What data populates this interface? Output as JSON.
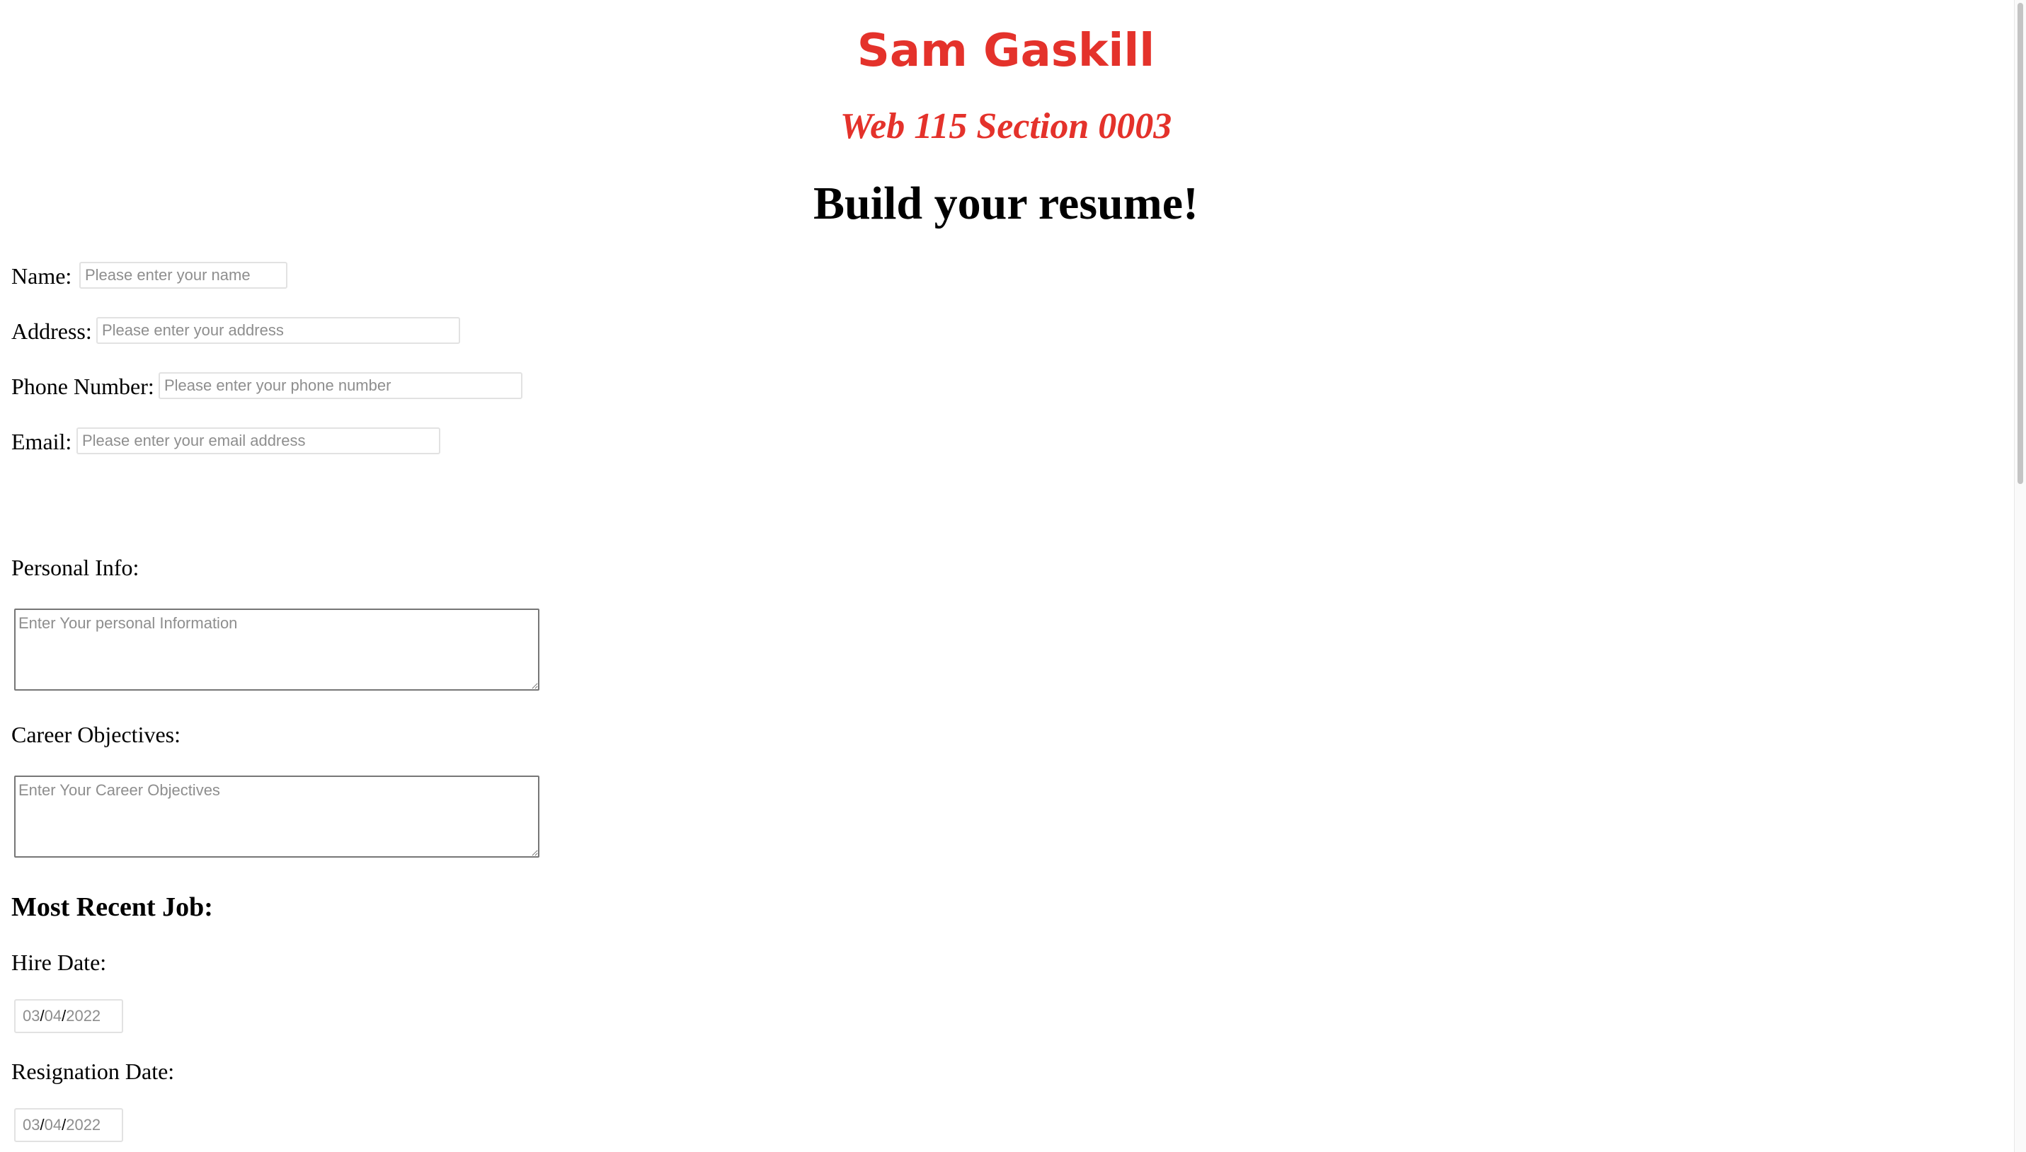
{
  "header": {
    "author_name": "Sam Gaskill",
    "course": "Web 115 Section 0003",
    "page_title": "Build your resume!"
  },
  "contact": {
    "name_label": "Name:",
    "name_placeholder": "Please enter your name",
    "name_value": "",
    "address_label": "Address:",
    "address_placeholder": "Please enter your address",
    "address_value": "",
    "phone_label": "Phone Number:",
    "phone_placeholder": "Please enter your phone number",
    "phone_value": "",
    "email_label": "Email:",
    "email_placeholder": "Please enter your email address",
    "email_value": ""
  },
  "personal_info": {
    "label": "Personal Info:",
    "placeholder": "Enter Your personal Information",
    "value": ""
  },
  "career_objectives": {
    "label": "Career Objectives:",
    "placeholder": "Enter Your Career Objectives",
    "value": ""
  },
  "most_recent_job": {
    "heading": "Most Recent Job:",
    "hire_date_label": "Hire Date:",
    "hire_date": {
      "month": "03",
      "day": "04",
      "year": "2022",
      "separator": "/"
    },
    "resignation_date_label": "Resignation Date:",
    "resignation_date": {
      "month": "03",
      "day": "04",
      "year": "2022",
      "separator": "/"
    }
  },
  "colors": {
    "accent_red": "#e4322b",
    "placeholder_gray": "#8e8e8e",
    "input_border": "#e2e2e2",
    "textarea_border": "#767676"
  }
}
